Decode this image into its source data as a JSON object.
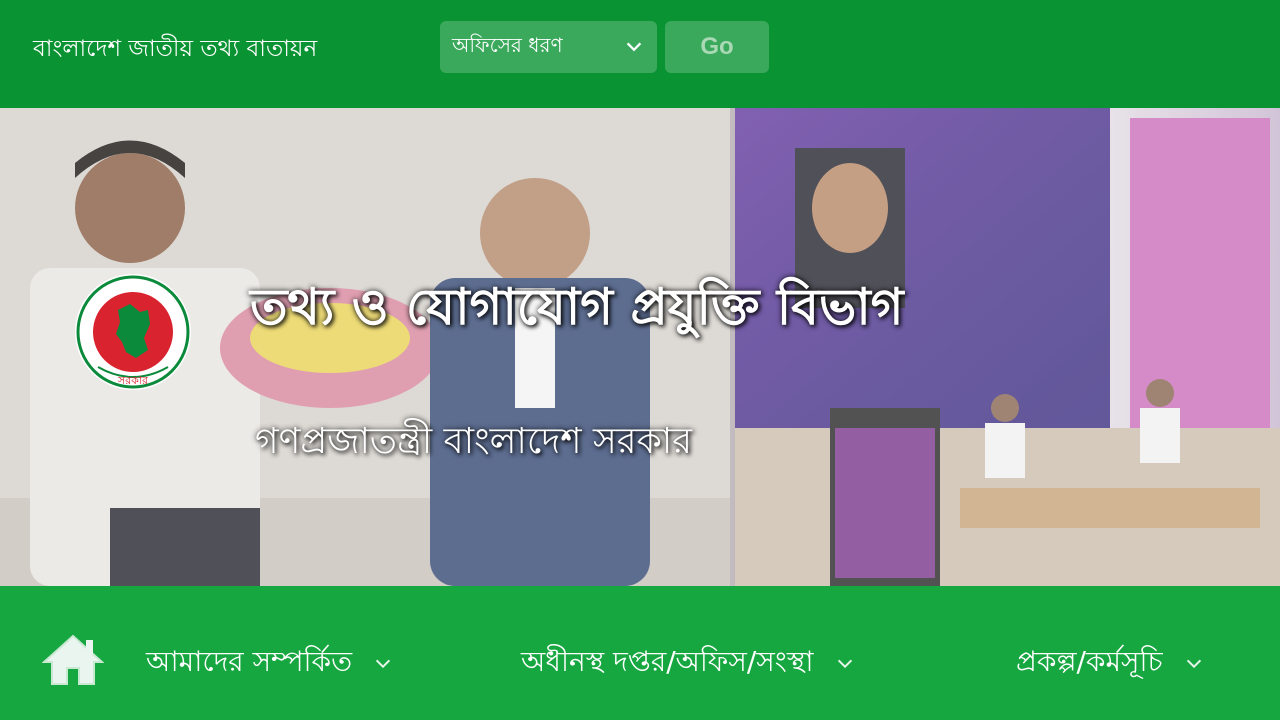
{
  "header": {
    "portal_title": "বাংলাদেশ জাতীয় তথ্য বাতায়ন",
    "office_type_select": {
      "value": "অফিসের ধরণ",
      "icon": "chevron-down-icon"
    },
    "go_label": "Go"
  },
  "banner": {
    "ministry_title": "তথ্য ও যোগাযোগ প্রযুক্তি বিভাগ",
    "government_title": "গণপ্রজাতন্ত্রী বাংলাদেশ সরকার",
    "emblem": {
      "ring_text": "গণপ্রজাতন্ত্রী বাংলাদেশ",
      "bottom_text": "সরকার"
    }
  },
  "nav": {
    "home_icon": "home-icon",
    "items": [
      {
        "label": "আমাদের সম্পর্কিত",
        "icon": "chevron-down-icon"
      },
      {
        "label": "অধীনস্থ দপ্তর/অফিস/সংস্থা",
        "icon": "chevron-down-icon"
      },
      {
        "label": "প্রকল্প/কর্মসূচি",
        "icon": "chevron-down-icon"
      }
    ]
  },
  "colors": {
    "header_green": "#0a9332",
    "nav_green": "#17a740",
    "select_bg": "#3aa95c"
  }
}
